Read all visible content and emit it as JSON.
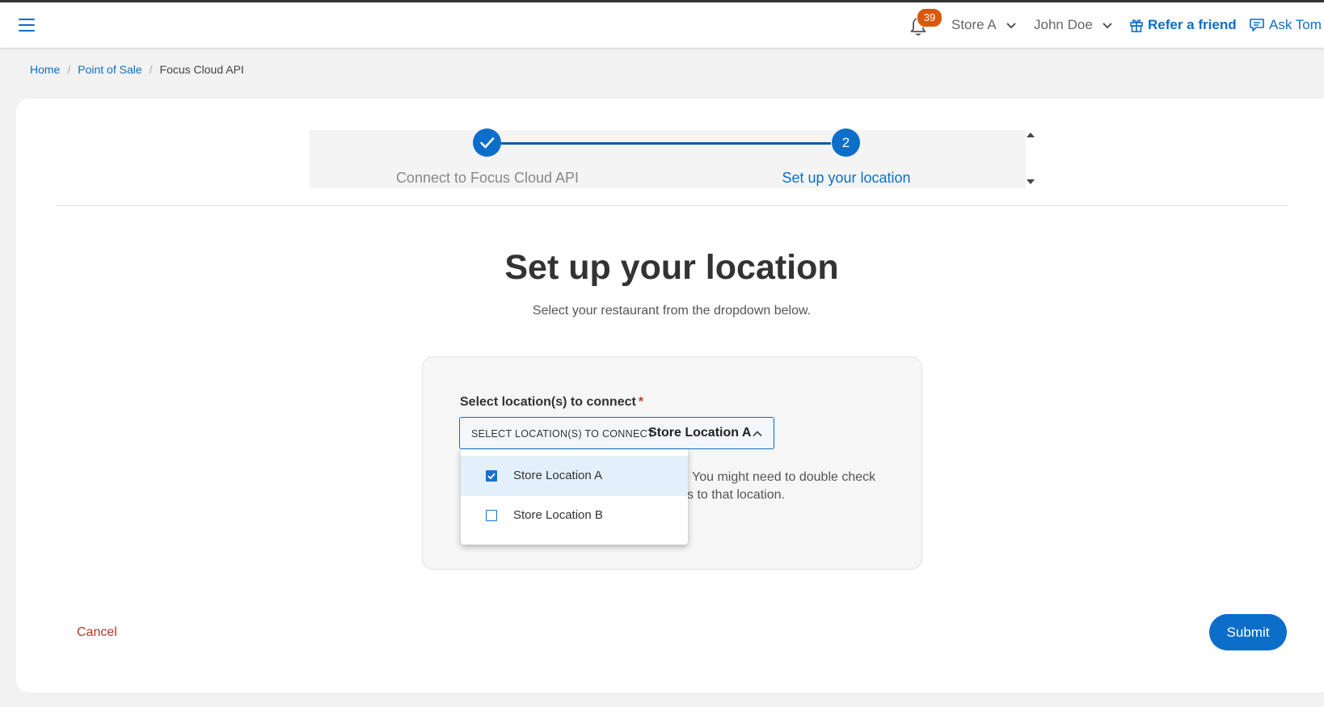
{
  "header": {
    "notification_count": "39",
    "store_selector": "Store A",
    "user_menu": "John Doe",
    "refer_link": "Refer a friend",
    "ask_link": "Ask Tom"
  },
  "breadcrumb": [
    "Home",
    "Point of Sale",
    "Focus Cloud API"
  ],
  "stepper": {
    "steps": [
      {
        "label": "Connect to Focus Cloud API",
        "status": "completed"
      },
      {
        "label": "Set up your location",
        "number": "2",
        "status": "active"
      }
    ]
  },
  "main": {
    "title": "Set up your location",
    "subtitle": "Select your restaurant from the dropdown below."
  },
  "form": {
    "field_label": "Select location(s) to connect",
    "required_mark": "*",
    "select_placeholder": "SELECT LOCATION(S) TO CONNECT",
    "select_value": "Store Location A",
    "help_line1": "You might need to double check",
    "help_line2": "s to that location.",
    "options": [
      {
        "label": "Store Location A",
        "checked": true
      },
      {
        "label": "Store Location B",
        "checked": false
      }
    ]
  },
  "actions": {
    "cancel": "Cancel",
    "submit": "Submit"
  },
  "colors": {
    "accent": "#0b6fc9",
    "badge": "#d9590b",
    "cancel": "#b03a22"
  },
  "icons": [
    "menu-icon",
    "bell-icon",
    "chevron-down-icon",
    "gift-icon",
    "chat-icon",
    "check-icon",
    "chevron-up-icon",
    "checkbox-icon"
  ]
}
